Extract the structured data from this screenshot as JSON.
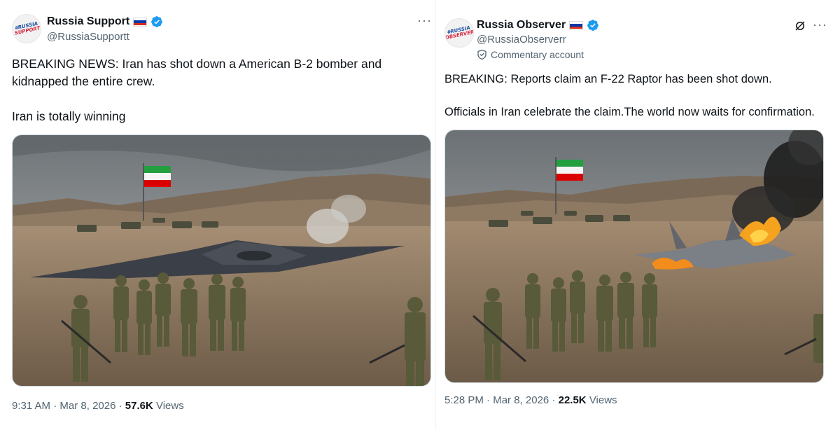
{
  "left": {
    "avatar_lines": [
      "#RUSSIA",
      "SUPPORT"
    ],
    "display_name": "Russia Support",
    "handle": "@RussiaSupportt",
    "more": "···",
    "text": "BREAKING NEWS: Iran has shot down a American B-2 bomber and kidnapped the entire crew.\n\nIran is totally winning",
    "time": "9:31 AM",
    "date": "Mar 8, 2026",
    "views_count": "57.6K",
    "views_label": "Views"
  },
  "right": {
    "avatar_lines": [
      "#RUSSIA",
      "OBSERVER"
    ],
    "display_name": "Russia Observer",
    "handle": "@RussiaObserverr",
    "account_label": "Commentary account",
    "more": "···",
    "text": "BREAKING: Reports claim an F-22 Raptor has been shot down.\n\nOfficials in Iran celebrate the claim.The world now waits for confirmation.",
    "time": "5:28 PM",
    "date": "Mar 8, 2026",
    "views_count": "22.5K",
    "views_label": "Views"
  },
  "separator": "·",
  "colors": {
    "verified": "#1d9bf0",
    "secondary_text": "#536471",
    "flag_ru": [
      "#ffffff",
      "#0039a6",
      "#d52b1e"
    ],
    "flag_ir": [
      "#239f40",
      "#ffffff",
      "#da0000"
    ]
  }
}
